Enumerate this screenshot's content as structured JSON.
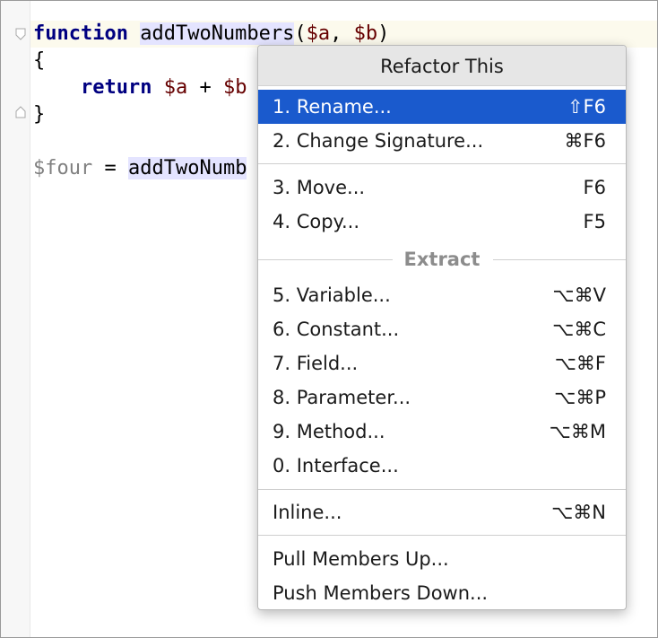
{
  "editor": {
    "lines": {
      "l1": {
        "kw": "function",
        "sp1": " ",
        "fn": "addTwoNumbers",
        "open": "(",
        "a": "$a",
        "comma": ", ",
        "b": "$b",
        "close": ")"
      },
      "l2": {
        "text": "{"
      },
      "l3": {
        "indent": "    ",
        "kw": "return",
        "sp": " ",
        "a": "$a",
        "op": " + ",
        "b": "$b"
      },
      "l4": {
        "text": "}"
      },
      "l6": {
        "var": "$four",
        "eq": " = ",
        "call": "addTwoNumb"
      }
    }
  },
  "popup": {
    "title": "Refactor This",
    "groups": {
      "g1": [
        {
          "label": "1. Rename...",
          "shortcut": "⇧F6",
          "selected": true
        },
        {
          "label": "2. Change Signature...",
          "shortcut": "⌘F6"
        }
      ],
      "g2": [
        {
          "label": "3. Move...",
          "shortcut": "F6"
        },
        {
          "label": "4. Copy...",
          "shortcut": "F5"
        }
      ],
      "extract_header": "Extract",
      "g3": [
        {
          "label": "5. Variable...",
          "shortcut": "⌥⌘V"
        },
        {
          "label": "6. Constant...",
          "shortcut": "⌥⌘C"
        },
        {
          "label": "7. Field...",
          "shortcut": "⌥⌘F"
        },
        {
          "label": "8. Parameter...",
          "shortcut": "⌥⌘P"
        },
        {
          "label": "9. Method...",
          "shortcut": "⌥⌘M"
        },
        {
          "label": "0. Interface...",
          "shortcut": ""
        }
      ],
      "g4": [
        {
          "label": "Inline...",
          "shortcut": "⌥⌘N"
        }
      ],
      "g5": [
        {
          "label": "Pull Members Up...",
          "shortcut": ""
        },
        {
          "label": "Push Members Down...",
          "shortcut": ""
        }
      ]
    }
  },
  "colors": {
    "selection": "#1a5acd",
    "keyword": "#000080",
    "variable": "#660000",
    "identifier_highlight": "#e4e4ff"
  }
}
